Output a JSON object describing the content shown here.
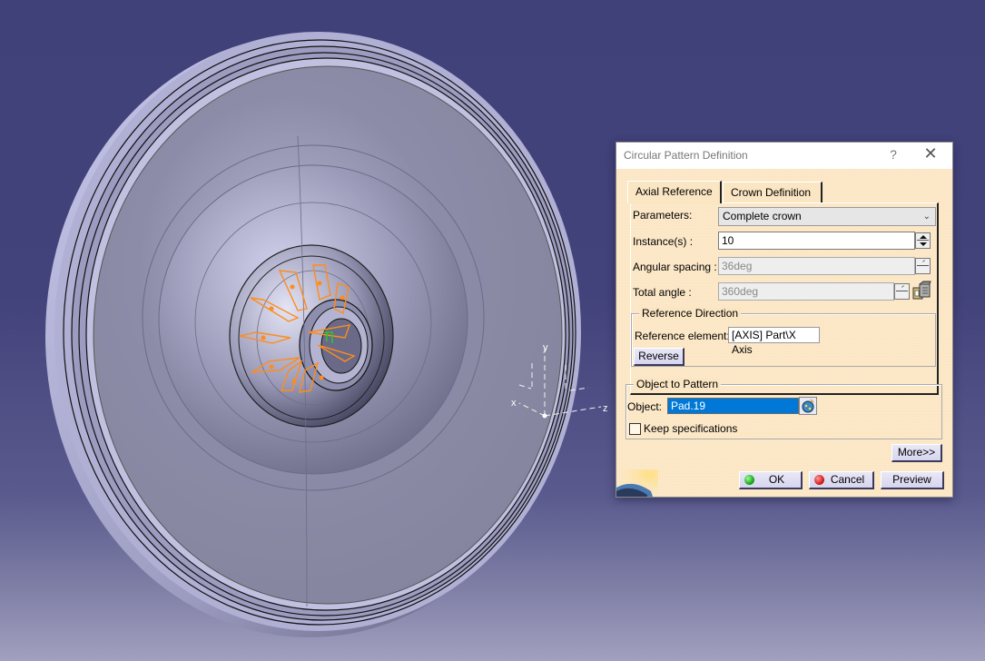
{
  "viewport": {
    "axis_labels": {
      "x": "x",
      "y": "y",
      "z": "z"
    },
    "colors": {
      "background_top": "#41417a",
      "background_bottom": "#a1a0bf",
      "part_surface": "#8a8aa6",
      "sketch_highlight": "#ff8c1a",
      "axis_marker": "#22cc22"
    }
  },
  "dialog": {
    "title": "Circular Pattern Definition",
    "help_icon": "?",
    "close_icon": "✕",
    "tabs": [
      {
        "label": "Axial Reference",
        "active": true
      },
      {
        "label": "Crown Definition",
        "active": false
      }
    ],
    "parameters": {
      "label": "Parameters:",
      "value": "Complete crown"
    },
    "instances": {
      "label": "Instance(s) :",
      "value": "10"
    },
    "angular_spacing": {
      "label": "Angular spacing :",
      "value": "36deg",
      "enabled": false
    },
    "total_angle": {
      "label": "Total angle :",
      "value": "360deg",
      "enabled": false
    },
    "reference_direction": {
      "legend": "Reference Direction",
      "element_label": "Reference element:",
      "element_value": "[AXIS] Part\\X Axis",
      "reverse_label": "Reverse"
    },
    "object_to_pattern": {
      "legend": "Object to Pattern",
      "object_label": "Object:",
      "object_value": "Pad.19",
      "keep_spec_label": "Keep specifications",
      "keep_spec_checked": false
    },
    "buttons": {
      "more": "More>>",
      "ok": "OK",
      "cancel": "Cancel",
      "preview": "Preview"
    },
    "colors": {
      "background": "#fbe6c4",
      "selection": "#0078d7",
      "ok_dot": "#1faa1f",
      "cancel_dot": "#d82020"
    }
  }
}
